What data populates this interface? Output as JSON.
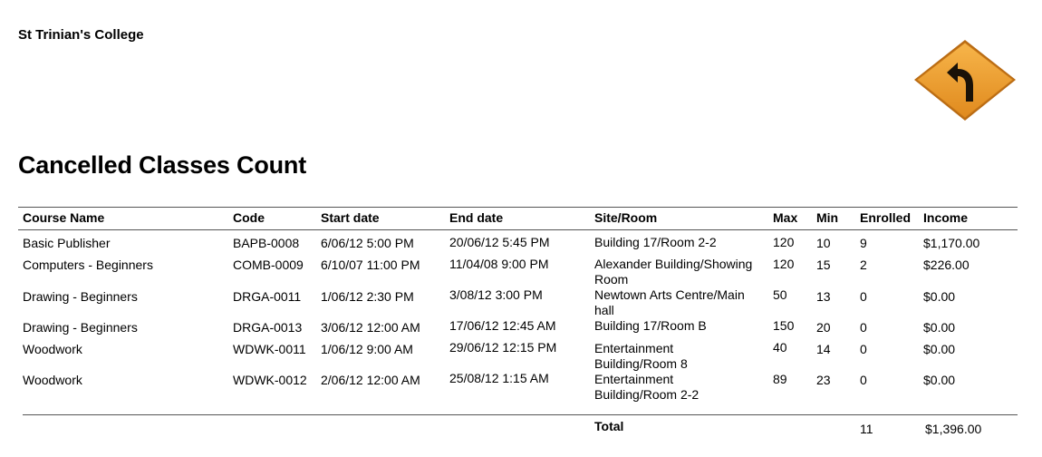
{
  "header": {
    "college": "St Trinian's College",
    "title": "Cancelled Classes Count"
  },
  "logo": {
    "icon": "curve-left-road-sign-icon",
    "color": "#F0A030"
  },
  "table": {
    "headers": {
      "name": "Course Name",
      "code": "Code",
      "start": "Start date",
      "end": "End date",
      "site": "Site/Room",
      "max": "Max",
      "min": "Min",
      "enrolled": "Enrolled",
      "income": "Income"
    },
    "rows": [
      {
        "name": "Basic Publisher",
        "code": "BAPB-0008",
        "start": "6/06/12 5:00 PM",
        "end": "20/06/12 5:45 PM",
        "site": "Building 17/Room 2-2",
        "max": "120",
        "min": "10",
        "enrolled": "9",
        "income": "$1,170.00"
      },
      {
        "name": "Computers - Beginners",
        "code": "COMB-0009",
        "start": "6/10/07 11:00 PM",
        "end": "11/04/08 9:00 PM",
        "site": "Alexander Building/Showing Room",
        "max": "120",
        "min": "15",
        "enrolled": "2",
        "income": "$226.00"
      },
      {
        "name": "Drawing - Beginners",
        "code": "DRGA-0011",
        "start": "1/06/12 2:30 PM",
        "end": "3/08/12 3:00 PM",
        "site": "Newtown Arts Centre/Main hall",
        "max": "50",
        "min": "13",
        "enrolled": "0",
        "income": "$0.00"
      },
      {
        "name": "Drawing - Beginners",
        "code": "DRGA-0013",
        "start": "3/06/12 12:00 AM",
        "end": "17/06/12 12:45 AM",
        "site": "Building 17/Room B",
        "max": "150",
        "min": "20",
        "enrolled": "0",
        "income": "$0.00"
      },
      {
        "name": "Woodwork",
        "code": "WDWK-0011",
        "start": "1/06/12 9:00 AM",
        "end": "29/06/12 12:15 PM",
        "site": "Entertainment Building/Room 8",
        "max": "40",
        "min": "14",
        "enrolled": "0",
        "income": "$0.00"
      },
      {
        "name": "Woodwork",
        "code": "WDWK-0012",
        "start": "2/06/12 12:00 AM",
        "end": "25/08/12 1:15 AM",
        "site": "Entertainment Building/Room 2-2",
        "max": "89",
        "min": "23",
        "enrolled": "0",
        "income": "$0.00"
      }
    ],
    "total": {
      "label": "Total",
      "enrolled": "11",
      "income": "$1,396.00"
    }
  }
}
